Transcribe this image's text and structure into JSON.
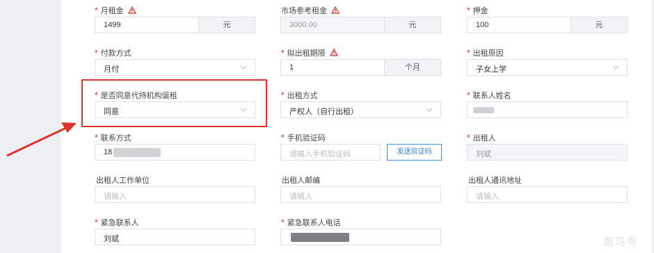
{
  "row1": {
    "rent": {
      "label": "月租金",
      "value": "1499",
      "unit": "元"
    },
    "market_rent": {
      "label": "市场参考租金",
      "value": "3000.00",
      "unit": "元"
    },
    "deposit": {
      "label": "押金",
      "value": "100",
      "unit": "元"
    }
  },
  "row2": {
    "payment": {
      "label": "付款方式",
      "value": "月付"
    },
    "lease_term": {
      "label": "拟出租期限",
      "value": "1",
      "unit": "个月"
    },
    "reason": {
      "label": "出租原因",
      "value": "子女上学"
    }
  },
  "row3": {
    "agree_agency": {
      "label": "是否同意代持机构诞租",
      "value": "同意"
    },
    "lease_mode": {
      "label": "出租方式",
      "value": "产权人（自行出租）"
    },
    "contact_name": {
      "label": "联系人姓名",
      "value": ""
    }
  },
  "row4": {
    "contact_phone": {
      "label": "联系方式",
      "value": "18"
    },
    "sms_code": {
      "label": "手机验证码",
      "placeholder": "请输入手机验证码",
      "button": "发送验证码"
    },
    "lessor": {
      "label": "出租人",
      "value": "刘斌"
    }
  },
  "row5": {
    "employer": {
      "label": "出租人工作单位",
      "placeholder": "请输入"
    },
    "postcode": {
      "label": "出租人邮编",
      "placeholder": "请输入"
    },
    "address": {
      "label": "出租人通讯地址",
      "placeholder": "请输入"
    }
  },
  "row6": {
    "emergency_contact": {
      "label": "紧急联系人",
      "value": "刘斌"
    },
    "emergency_phone": {
      "label": "紧急联系人电话",
      "value": ""
    }
  },
  "watermark": "斑马号",
  "colors": {
    "required": "#e1251b",
    "annotation": "#e0322c",
    "link": "#2f7fd8"
  }
}
